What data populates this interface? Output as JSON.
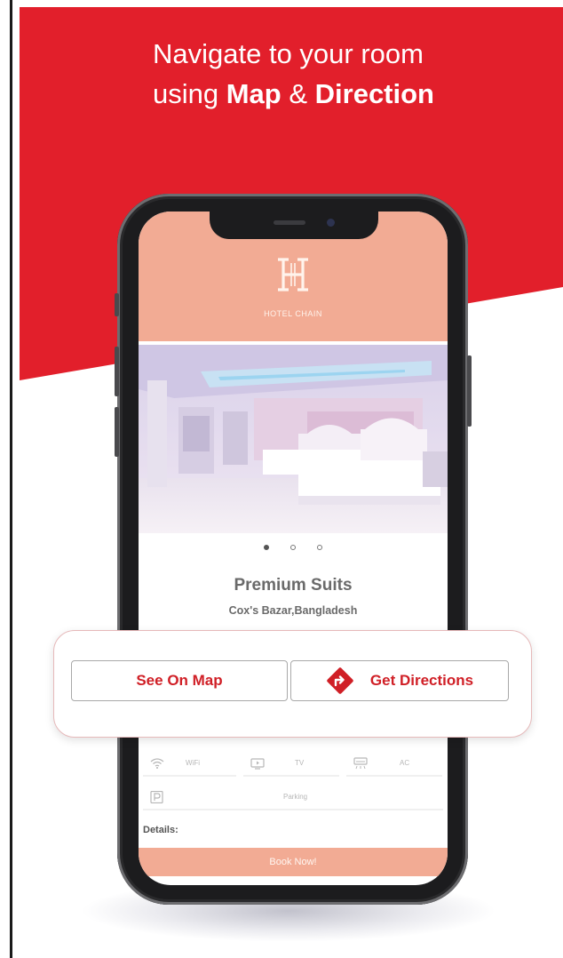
{
  "promo": {
    "line1": "Navigate to your room",
    "line2_prefix": "using ",
    "line2_bold1": "Map",
    "line2_mid": " & ",
    "line2_bold2": "Direction"
  },
  "colors": {
    "brand_red": "#e21f2b",
    "app_salmon": "#f2ab94",
    "button_text_red": "#d01f26"
  },
  "app": {
    "brand": "HOTEL CHAIN",
    "logo_icon": "hotel-chain-logo",
    "carousel": {
      "slides": 3,
      "active_index": 0
    },
    "room": {
      "title": "Premium Suits",
      "location": "Cox's Bazar,Bangladesh"
    },
    "amenities": [
      {
        "icon": "wifi-icon",
        "label": "WiFi"
      },
      {
        "icon": "tv-icon",
        "label": "TV"
      },
      {
        "icon": "ac-icon",
        "label": "AC"
      },
      {
        "icon": "parking-icon",
        "label": "Parking"
      }
    ],
    "details_label": "Details:",
    "book_button": "Book Now!"
  },
  "actions": {
    "see_on_map": "See On Map",
    "get_directions": "Get Directions",
    "directions_icon": "directions-icon"
  }
}
